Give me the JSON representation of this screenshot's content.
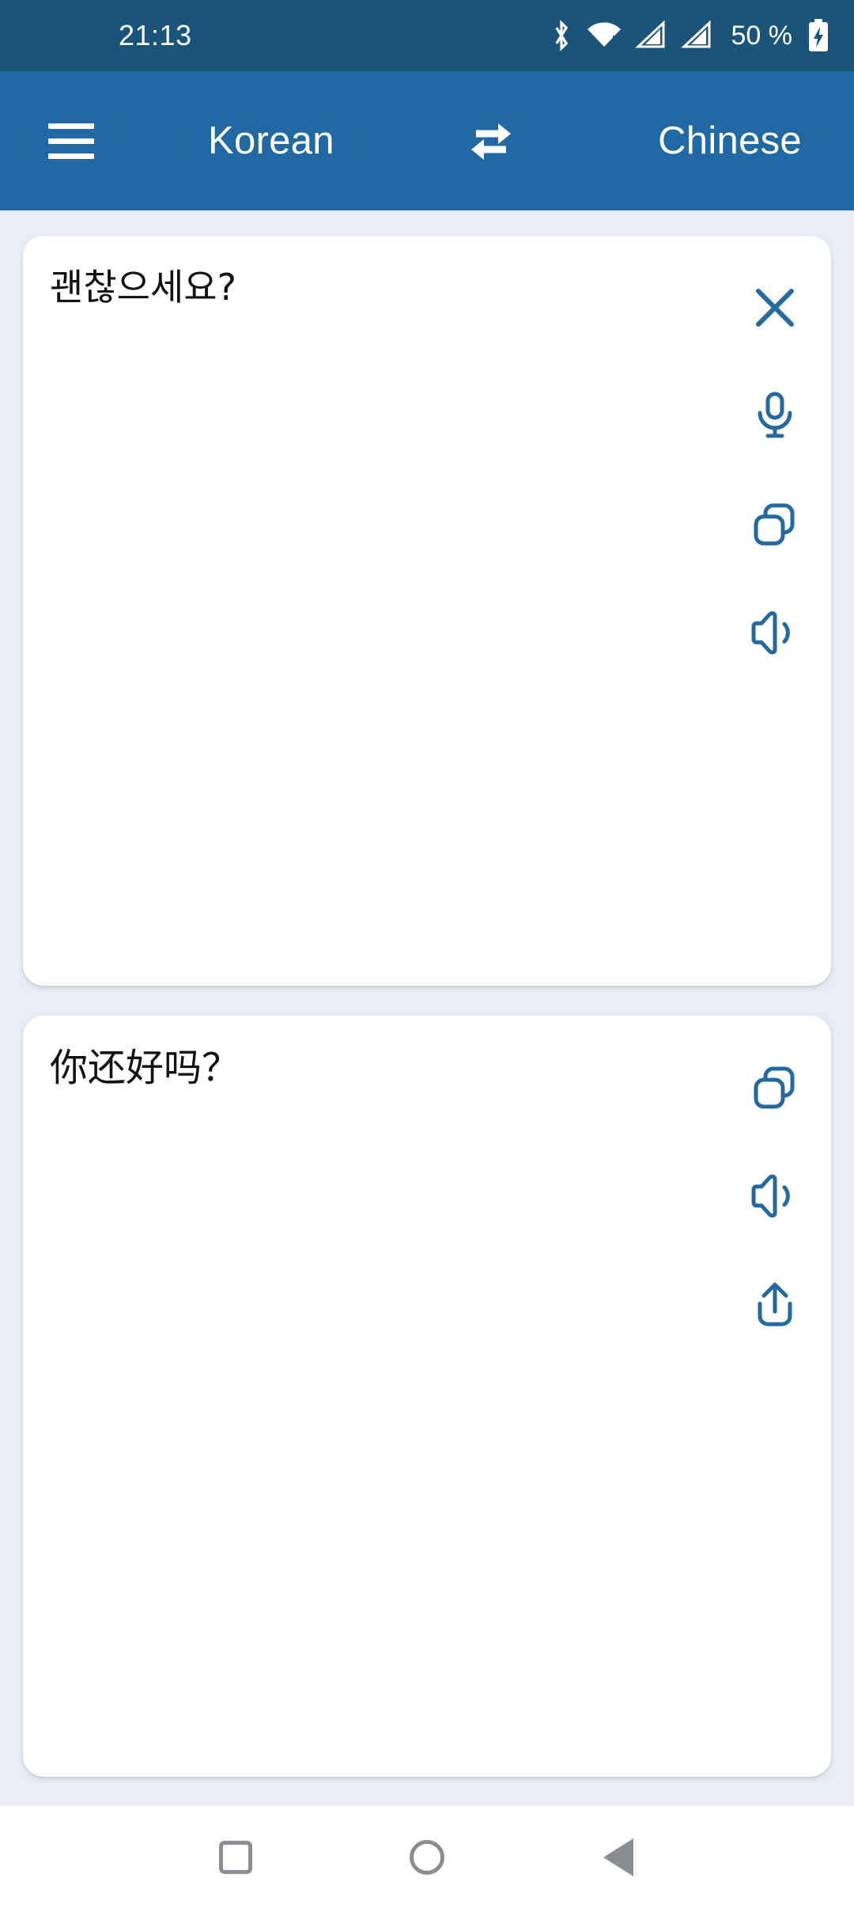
{
  "status_bar": {
    "clock": "21:13",
    "battery_text": "50 %",
    "icons": [
      "bluetooth-icon",
      "wifi-icon",
      "signal-sim1-icon",
      "signal-sim2-icon",
      "battery-charging-icon"
    ],
    "background_color": "#1b5479",
    "foreground_color": "#ffffff"
  },
  "toolbar": {
    "menu_label": "menu",
    "source_language": "Korean",
    "target_language": "Chinese",
    "swap_label": "swap-languages",
    "background_color": "#2169a5",
    "foreground_color": "#ffffff"
  },
  "theme": {
    "page_background": "#e8edf5",
    "card_background": "#ffffff",
    "accent": "#24699f",
    "text_color": "#121212",
    "nav_icon_color": "#8a8d91"
  },
  "source_card": {
    "text": "괜찮으세요?",
    "actions": [
      {
        "name": "clear-button",
        "icon": "close-icon"
      },
      {
        "name": "speak-button",
        "icon": "microphone-icon"
      },
      {
        "name": "copy-button",
        "icon": "copy-icon"
      },
      {
        "name": "listen-button",
        "icon": "speaker-icon"
      }
    ]
  },
  "target_card": {
    "text": "你还好吗？",
    "actions": [
      {
        "name": "copy-button",
        "icon": "copy-icon"
      },
      {
        "name": "listen-button",
        "icon": "speaker-icon"
      },
      {
        "name": "share-button",
        "icon": "share-icon"
      }
    ]
  },
  "nav_bar": {
    "recents_label": "recents",
    "home_label": "home",
    "back_label": "back"
  }
}
